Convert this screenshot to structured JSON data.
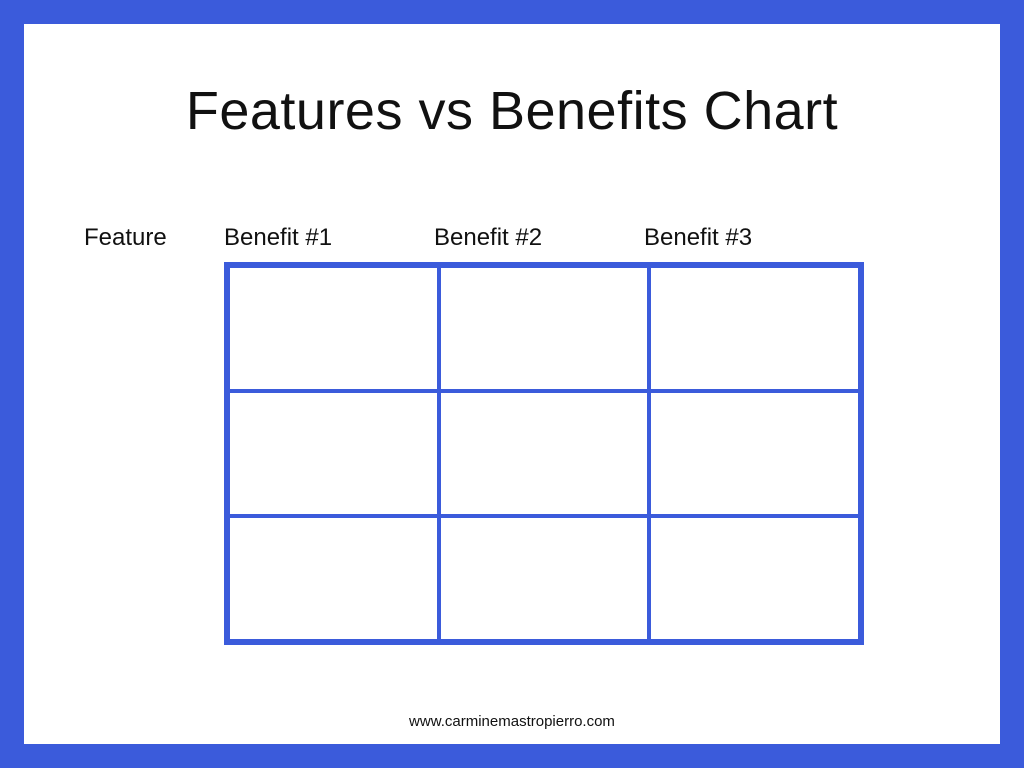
{
  "title": "Features vs Benefits Chart",
  "columns": {
    "feature": "Feature",
    "benefit1": "Benefit #1",
    "benefit2": "Benefit #2",
    "benefit3": "Benefit #3"
  },
  "grid": {
    "rows": 3,
    "cols": 3,
    "cells": [
      [
        "",
        "",
        ""
      ],
      [
        "",
        "",
        ""
      ],
      [
        "",
        "",
        ""
      ]
    ]
  },
  "footer": "www.carminemastropierro.com",
  "colors": {
    "border": "#3b5bdb"
  }
}
